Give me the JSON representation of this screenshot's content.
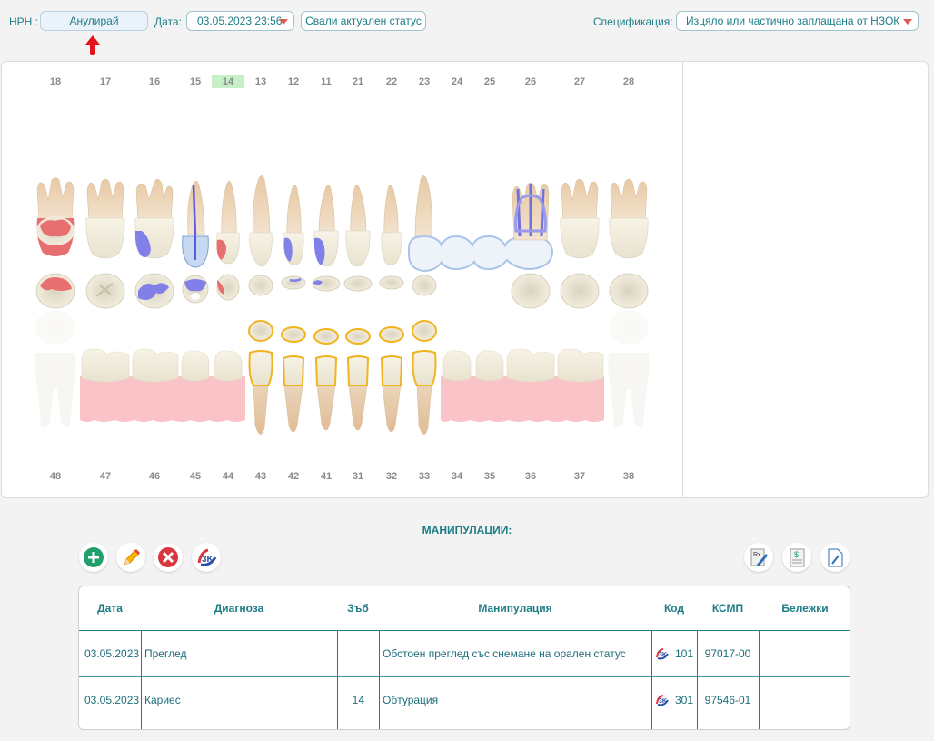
{
  "topbar": {
    "nrn_label": "НРН :",
    "nrn_button": "Анулирай",
    "date_label": "Дата:",
    "date_value": "03.05.2023 23:56",
    "status_button": "Свали актуален статус",
    "spec_label": "Спецификация:",
    "spec_value": "Изцяло или частично заплащана от НЗОК"
  },
  "chart": {
    "upper_numbers": [
      "18",
      "17",
      "16",
      "15",
      "14",
      "13",
      "12",
      "11",
      "21",
      "22",
      "23",
      "24",
      "25",
      "26",
      "27",
      "28"
    ],
    "lower_numbers": [
      "48",
      "47",
      "46",
      "45",
      "44",
      "43",
      "42",
      "41",
      "31",
      "32",
      "33",
      "34",
      "35",
      "36",
      "37",
      "38"
    ],
    "selected_tooth": "14",
    "colors": {
      "caries": "#e35b5b",
      "filling": "#6b6be8",
      "bridge": "#b5cde8",
      "implant_outline": "#f0b41e",
      "gum": "#f9c3c8"
    }
  },
  "manipulations": {
    "title": "МАНИПУЛАЦИИ:",
    "toolbar_icons": [
      "add-icon",
      "edit-icon",
      "delete-icon",
      "nzok-icon",
      "prescription-icon",
      "invoice-icon",
      "document-icon"
    ],
    "columns": [
      "Дата",
      "Диагноза",
      "Зъб",
      "Манипулация",
      "Код",
      "КСМП",
      "Бележки"
    ],
    "rows": [
      {
        "date": "03.05.2023",
        "diagnosis": "Преглед",
        "tooth": "",
        "manipulation": "Обстоен преглед със снемане на орален статус",
        "code": "101",
        "ksmp": "97017-00",
        "notes": ""
      },
      {
        "date": "03.05.2023",
        "diagnosis": "Кариес",
        "tooth": "14",
        "manipulation": "Обтурация",
        "code": "301",
        "ksmp": "97546-01",
        "notes": ""
      }
    ]
  }
}
